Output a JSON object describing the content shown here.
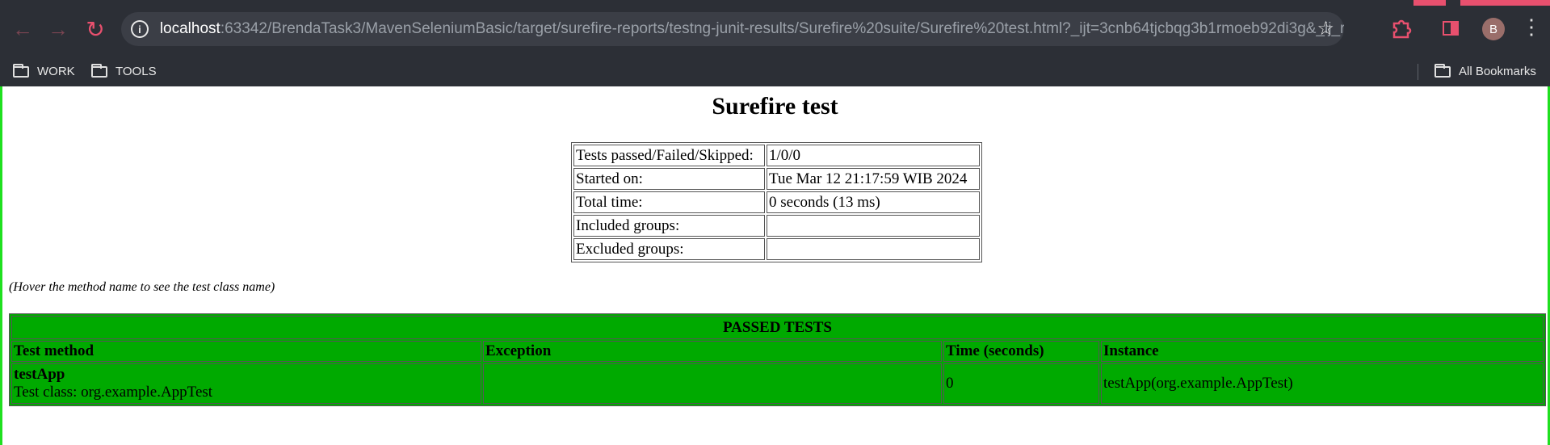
{
  "browser": {
    "url_host": "localhost",
    "url_rest": ":63342/BrendaTask3/MavenSeleniumBasic/target/surefire-reports/testng-junit-results/Surefire%20suite/Surefire%20test.html?_ijt=3cnb64tjcbqg3b1rmoeb92di3g&_ij_reload=REL...",
    "avatar_letter": "B",
    "accent_color": "#e8506e",
    "bookmarks": [
      {
        "label": "WORK",
        "icon": "folder-icon"
      },
      {
        "label": "TOOLS",
        "icon": "folder-icon"
      }
    ],
    "all_bookmarks": "All Bookmarks"
  },
  "report": {
    "title": "Surefire test",
    "summary": [
      {
        "key": "Tests passed/Failed/Skipped:",
        "value": "1/0/0"
      },
      {
        "key": "Started on:",
        "value": "Tue Mar 12 21:17:59 WIB 2024"
      },
      {
        "key": "Total time:",
        "value": "0 seconds (13 ms)"
      },
      {
        "key": "Included groups:",
        "value": ""
      },
      {
        "key": "Excluded groups:",
        "value": ""
      }
    ],
    "hover_note": "(Hover the method name to see the test class name)",
    "passed": {
      "caption": "PASSED TESTS",
      "color": "#00aa00",
      "columns": [
        "Test method",
        "Exception",
        "Time (seconds)",
        "Instance"
      ],
      "rows": [
        {
          "method": "testApp",
          "test_class": "Test class: org.example.AppTest",
          "exception": "",
          "time": "0",
          "instance": "testApp(org.example.AppTest)"
        }
      ]
    }
  }
}
